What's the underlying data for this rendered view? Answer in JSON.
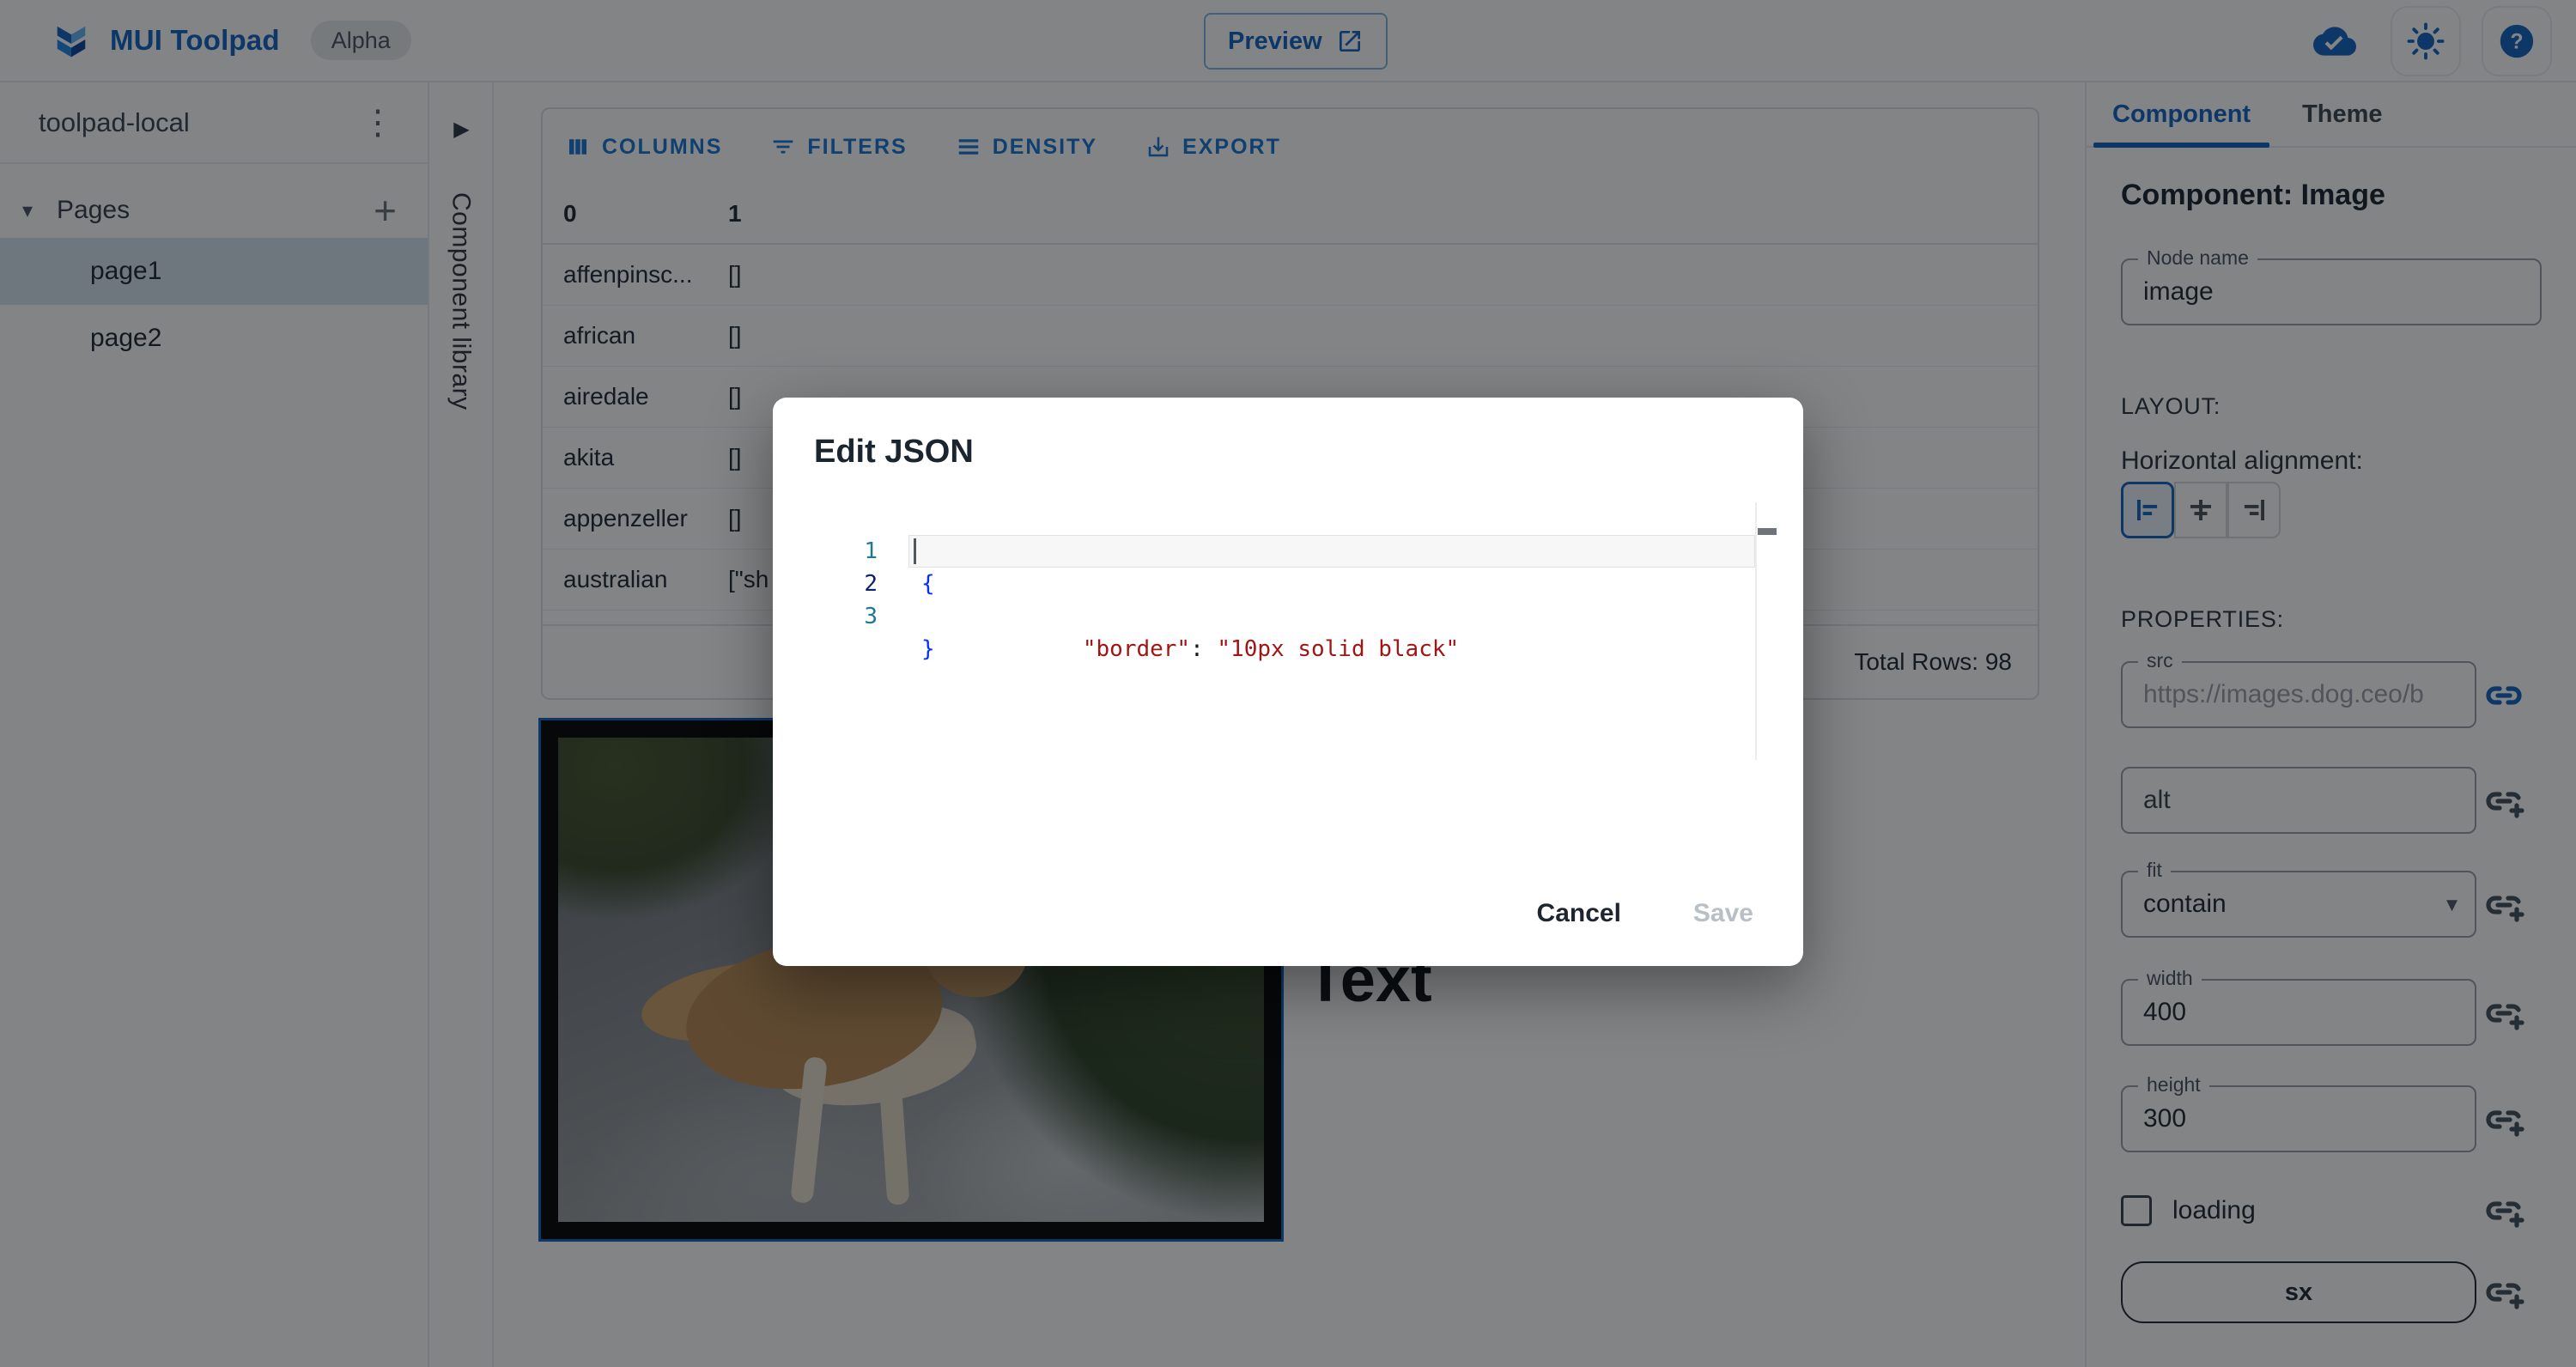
{
  "topbar": {
    "app_name": "MUI Toolpad",
    "alpha_badge": "Alpha",
    "preview_label": "Preview"
  },
  "sidebar": {
    "project_name": "toolpad-local",
    "pages_label": "Pages",
    "pages": [
      {
        "label": "page1",
        "selected": true
      },
      {
        "label": "page2",
        "selected": false
      }
    ]
  },
  "component_library": {
    "label": "Component library"
  },
  "grid": {
    "toolbar": [
      {
        "label": "COLUMNS"
      },
      {
        "label": "FILTERS"
      },
      {
        "label": "DENSITY"
      },
      {
        "label": "EXPORT"
      }
    ],
    "columns": [
      "0",
      "1"
    ],
    "rows": [
      [
        "affenpinsc...",
        "[]"
      ],
      [
        "african",
        "[]"
      ],
      [
        "airedale",
        "[]"
      ],
      [
        "akita",
        "[]"
      ],
      [
        "appenzeller",
        "[]"
      ],
      [
        "australian",
        "[\"sh"
      ]
    ],
    "footer": "Total Rows: 98"
  },
  "canvas": {
    "text_component": "Text"
  },
  "modal": {
    "title": "Edit JSON",
    "line_numbers": [
      "1",
      "2",
      "3"
    ],
    "code": {
      "open_brace": "{",
      "indent": "  ",
      "key": "\"border\"",
      "colon": ": ",
      "value": "\"10px solid black\"",
      "close_brace": "}"
    },
    "cancel_label": "Cancel",
    "save_label": "Save"
  },
  "inspector": {
    "tabs": [
      {
        "label": "Component",
        "active": true
      },
      {
        "label": "Theme",
        "active": false
      }
    ],
    "heading": "Component: Image",
    "node_name": {
      "label": "Node name",
      "value": "image"
    },
    "layout_label": "LAYOUT:",
    "horizontal_alignment_label": "Horizontal alignment:",
    "properties_label": "PROPERTIES:",
    "src": {
      "label": "src",
      "value": "https://images.dog.ceo/b"
    },
    "alt": {
      "label": "alt",
      "value": ""
    },
    "fit": {
      "label": "fit",
      "value": "contain"
    },
    "width": {
      "label": "width",
      "value": "400"
    },
    "height": {
      "label": "height",
      "value": "300"
    },
    "loading": {
      "label": "loading",
      "checked": false
    },
    "sx_label": "sx"
  },
  "colors": {
    "accent": "#1976d2",
    "selection_outline": "#1565c0",
    "code_line_number": "#237893",
    "code_line_number_active": "#0b216f",
    "code_brace": "#0431fa",
    "code_string": "#a31515"
  }
}
